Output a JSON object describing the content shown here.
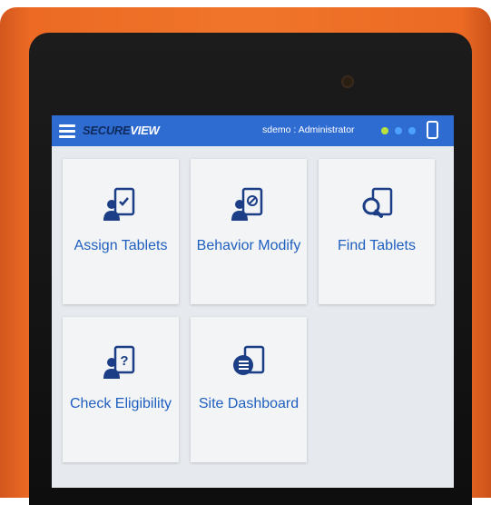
{
  "header": {
    "logo_part1": "SECURE",
    "logo_part2": "VIEW",
    "user": "sdemo : Administrator",
    "status_colors": [
      "#b9e23f",
      "#4ea0ff",
      "#4ea0ff"
    ]
  },
  "tiles": [
    {
      "label": "Assign Tablets",
      "icon": "assign-tablets-icon"
    },
    {
      "label": "Behavior Modify",
      "icon": "behavior-modify-icon"
    },
    {
      "label": "Find Tablets",
      "icon": "find-tablets-icon"
    },
    {
      "label": "Check Eligibility",
      "icon": "check-eligibility-icon"
    },
    {
      "label": "Site Dashboard",
      "icon": "site-dashboard-icon"
    }
  ],
  "colors": {
    "case": "#f0752a",
    "topbar": "#2f6cd1",
    "tile_text": "#1f5fbf",
    "icon": "#1b3e86"
  }
}
